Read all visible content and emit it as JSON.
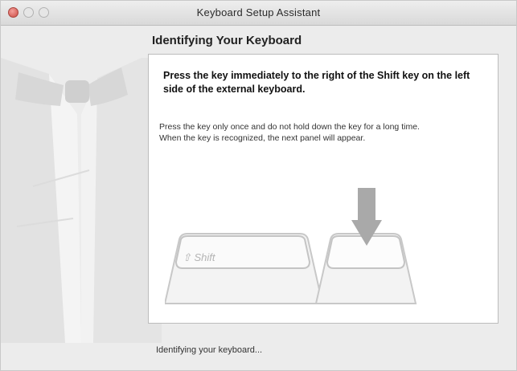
{
  "window": {
    "title": "Keyboard Setup Assistant"
  },
  "panel": {
    "heading": "Identifying Your Keyboard",
    "instruction": "Press the key immediately to the right of the Shift key on the left side of the external keyboard.",
    "note_line1": "Press the key only once and do not hold down the key for a long time.",
    "note_line2": "When the key is recognized, the next panel will appear."
  },
  "illustration": {
    "shift_key_label": "⇧ Shift",
    "icons": [
      "tuxedo-illustration",
      "down-arrow-icon",
      "shift-key-illustration",
      "target-key-illustration"
    ]
  },
  "status": {
    "text": "Identifying your keyboard..."
  },
  "colors": {
    "window_bg": "#ececec",
    "panel_bg": "#ffffff",
    "close_button": "#cc4b43",
    "arrow": "#a9a9a9"
  }
}
